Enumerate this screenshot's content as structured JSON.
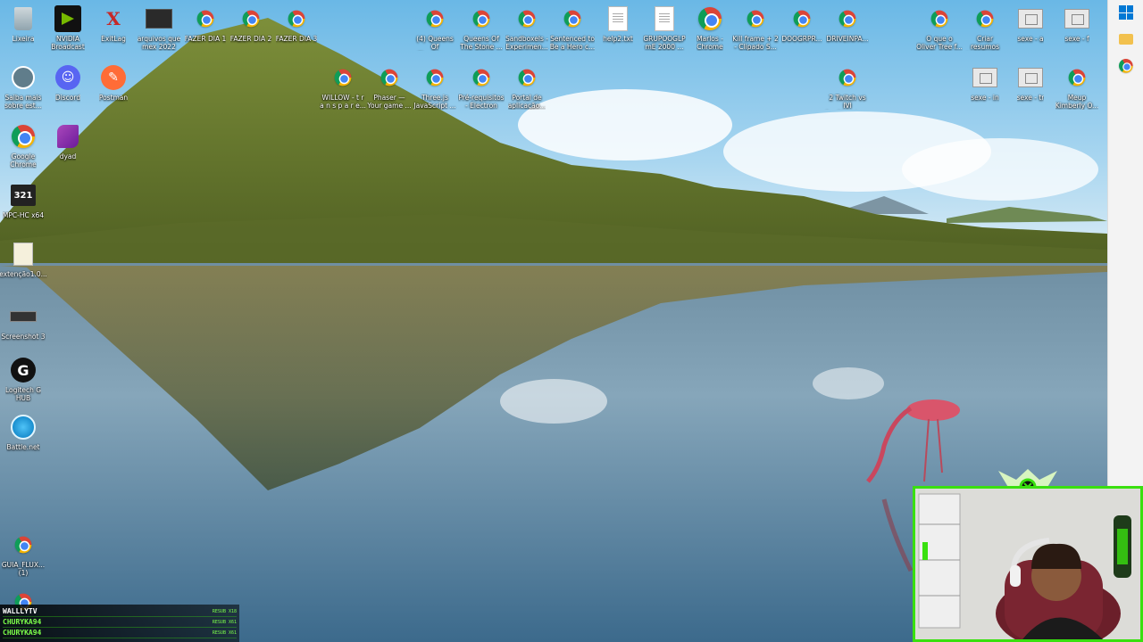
{
  "desktop_icons": {
    "lixeira": "Lixeira",
    "nvidia": "NVIDIA\nBroadcast",
    "exitlag": "ExitLag",
    "arquivos": "arquivos que\nmex 2022",
    "fazer1": "FAZER DIA 1",
    "fazer2": "FAZER DIA 2",
    "fazer3": "FAZER DIA 3",
    "queens1": "(4) Queens Of\nThe Stone A...",
    "queens2": "Queens Of\nThe Stone ...",
    "sandboxels": "Sandboxels -\nExperimen...",
    "sentenced": "Sentenced to\nBe a Hero c...",
    "help": "help2.txt",
    "grupo": "GRUPOOGLP\nmE 2000 ...",
    "marlos": "Marlos -\nChrome",
    "killframe": "Kill frame + 2\n- Clipado S...",
    "doograpr": "DOOGRPR...",
    "driveinpa": "DRIVEINPA...",
    "oque": "O que o\nOliver Tree f...",
    "criar": "Criar resumos\nde estudo ...",
    "sexec_a": "sexe - a",
    "sexec_f": "sexe - f",
    "saiba": "Saiba mais\nsobre est...",
    "discord": "Discord",
    "postman": "Postman",
    "willow": "WILLOW - t r\na n s p a r e...",
    "phaser": "Phaser —\nYour game ...",
    "threejs": "Three.js\nJavaScript ...",
    "prereq": "Pré-requisitos\n- Electron",
    "portal": "Portal de\naplicação...",
    "twitch": "2 Twitch vs IVI\n2 - Clipado ...",
    "sexec_in": "sexe - in",
    "sexec_tr": "sexe - tr",
    "meup": "Meup\nKimberly O...",
    "googlechrome": "Google\nChrome",
    "dyad": "dyad",
    "mpc": "MPC-HC x64",
    "extensao": "extenção1.0...",
    "screenshot": "Screenshot 3",
    "logitech": "Logitech G\nHUB",
    "battlenet": "Battle.net",
    "guia": "GUIA_FLUX...\n(1)",
    "chrome_bottom": ""
  },
  "chat": [
    {
      "user": "WALLLYTV",
      "tag": "RESUB X18"
    },
    {
      "user": "CHURYKA94",
      "tag": "RESUB X61"
    },
    {
      "user": "CHURYKA94",
      "tag": "RESUB X61"
    }
  ],
  "colors": {
    "accent": "#39e00f",
    "chat_name": "#7dff4a"
  }
}
